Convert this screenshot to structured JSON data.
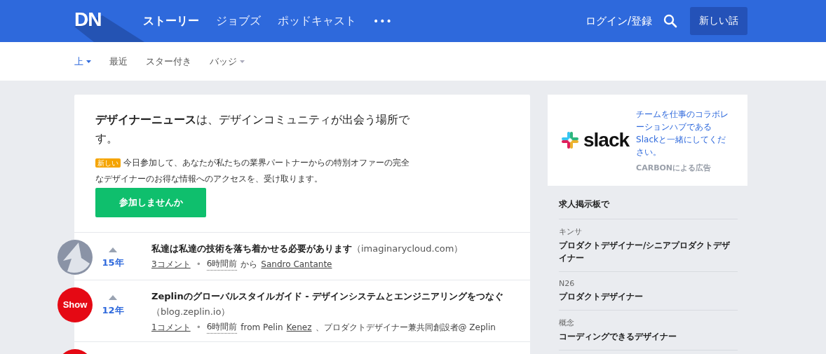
{
  "header": {
    "logo": "DN",
    "nav": [
      {
        "label": "ストーリー",
        "selected": true
      },
      {
        "label": "ジョブズ",
        "selected": false
      },
      {
        "label": "ポッドキャスト",
        "selected": false
      }
    ],
    "more": "•••",
    "login": "ログイン/登録",
    "new_button": "新しい話"
  },
  "subnav": [
    {
      "label": "上",
      "selected": true,
      "dropdown": true
    },
    {
      "label": "最近",
      "selected": false,
      "dropdown": false
    },
    {
      "label": "スター付き",
      "selected": false,
      "dropdown": false
    },
    {
      "label": "バッジ",
      "selected": false,
      "dropdown": true
    }
  ],
  "intro": {
    "headline": "**デザイナーニュース**は、デザインコミュニティが出会う場所です。",
    "badge": "新しい",
    "text": "今日参加して、あなたが私たちの業界パートナーからの特別オファーの完全なデザイナーのお得な情報へのアクセスを、受け取ります。",
    "button": "参加しませんか"
  },
  "stories": [
    {
      "avatar": {
        "kind": "figure"
      },
      "votes": "15年",
      "title": "私達は私達の技術を落ち着かせる必要があります",
      "domain": "（imaginarycloud.com）",
      "meta": [
        {
          "kind": "link",
          "text": "3コメント"
        },
        {
          "kind": "dot",
          "text": "•"
        },
        {
          "kind": "time",
          "text": "6時間前"
        },
        {
          "kind": "text",
          "text": "から"
        },
        {
          "kind": "link",
          "text": "Sandro Cantante"
        }
      ]
    },
    {
      "avatar": {
        "kind": "badge",
        "text": "Show"
      },
      "votes": "12年",
      "title": "Zeplinのグローバルスタイルガイド - デザインシステムとエンジニアリングをつなぐ",
      "domain": "（blog.zeplin.io）",
      "meta": [
        {
          "kind": "link",
          "text": "1コメント"
        },
        {
          "kind": "dot",
          "text": "•"
        },
        {
          "kind": "time",
          "text": "6時間前"
        },
        {
          "kind": "text",
          "text": "from Pelin"
        },
        {
          "kind": "link",
          "text": "Kenez"
        },
        {
          "kind": "text",
          "text": "、プロダクトデザイナー兼共同創設者@ Zeplin"
        }
      ]
    },
    {
      "avatar": {
        "kind": "badge"
      }
    }
  ],
  "ad": {
    "logo": "slack",
    "text": "チームを仕事のコラボレーションハブであるSlackと一緒にしてください。",
    "credit": "CARBONによる広告"
  },
  "jobs": {
    "title": "求人掲示板で",
    "items": [
      {
        "company": "キンサ",
        "role": "プロダクトデザイナー/シニアプロダクトデザイナー"
      },
      {
        "company": "N26",
        "role": "プロダクトデザイナー"
      },
      {
        "company": "概念",
        "role": "コーディングできるデザイナー"
      }
    ]
  }
}
